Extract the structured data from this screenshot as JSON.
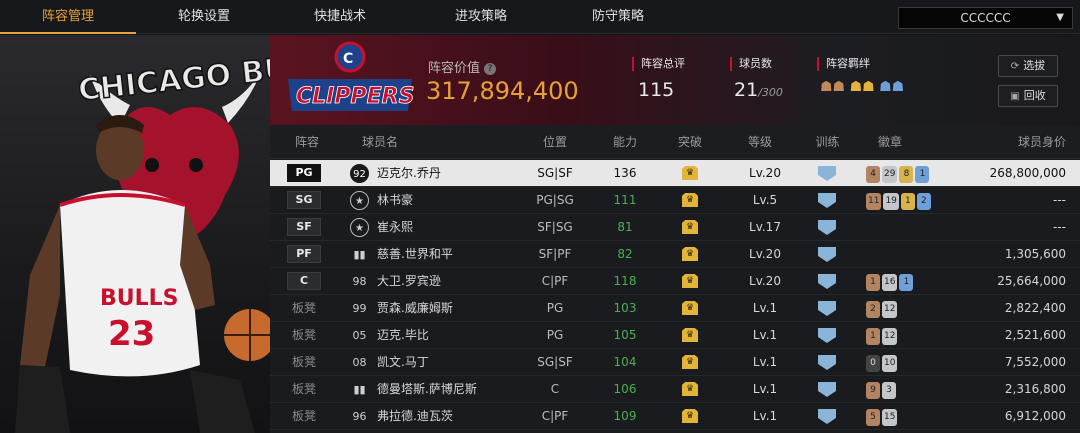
{
  "tabs": [
    "阵容管理",
    "轮换设置",
    "快捷战术",
    "进攻策略",
    "防守策略"
  ],
  "team_select": {
    "value": "CCCCCC"
  },
  "promo": {
    "team_text": "CHICAGO BULLS",
    "jersey_name": "BULLS",
    "jersey_number": "23"
  },
  "header": {
    "logo_text": "CLIPPERS",
    "lineup_value_label": "阵容价值",
    "lineup_value": "317,894,400",
    "stats": [
      {
        "label": "阵容总评",
        "value": "115",
        "suffix": ""
      },
      {
        "label": "球员数",
        "value": "21",
        "suffix": "/300"
      },
      {
        "label": "阵容羁绊",
        "value": "",
        "suffix": ""
      }
    ],
    "buttons": [
      {
        "label": "选拔",
        "icon": "refresh-icon"
      },
      {
        "label": "回收",
        "icon": "recycle-icon"
      }
    ]
  },
  "columns": [
    "阵容",
    "球员名",
    "位置",
    "能力",
    "突破",
    "等级",
    "训练",
    "徽章",
    "球员身价"
  ],
  "rows": [
    {
      "slot": "PG",
      "starter": true,
      "num": "92",
      "num_circle": true,
      "name": "迈克尔.乔丹",
      "pos": "SG|SF",
      "ability": "136",
      "level": "Lv.20",
      "badges": [
        [
          "4",
          "bronze"
        ],
        [
          "29",
          "silver"
        ],
        [
          "8",
          "gold"
        ],
        [
          "1",
          "blue"
        ]
      ],
      "price": "268,800,000",
      "selected": true
    },
    {
      "slot": "SG",
      "starter": true,
      "num": "★",
      "num_circle": true,
      "name": "林书豪",
      "pos": "PG|SG",
      "ability": "111",
      "level": "Lv.5",
      "badges": [
        [
          "11",
          "bronze"
        ],
        [
          "19",
          "silver"
        ],
        [
          "1",
          "gold"
        ],
        [
          "2",
          "blue"
        ]
      ],
      "price": "---"
    },
    {
      "slot": "SF",
      "starter": true,
      "num": "★",
      "num_circle": true,
      "name": "崔永熙",
      "pos": "SF|SG",
      "ability": "81",
      "level": "Lv.17",
      "badges": [],
      "price": "---"
    },
    {
      "slot": "PF",
      "starter": true,
      "num": "▮▮",
      "num_circle": false,
      "name": "慈善.世界和平",
      "pos": "SF|PF",
      "ability": "82",
      "level": "Lv.20",
      "badges": [],
      "price": "1,305,600"
    },
    {
      "slot": "C",
      "starter": true,
      "num": "98",
      "num_circle": false,
      "name": "大卫.罗宾逊",
      "pos": "C|PF",
      "ability": "118",
      "level": "Lv.20",
      "badges": [
        [
          "1",
          "bronze"
        ],
        [
          "16",
          "silver"
        ],
        [
          "1",
          "blue"
        ]
      ],
      "price": "25,664,000"
    },
    {
      "slot": "板凳",
      "starter": false,
      "num": "99",
      "num_circle": false,
      "name": "贾森.威廉姆斯",
      "pos": "PG",
      "ability": "103",
      "level": "Lv.1",
      "badges": [
        [
          "2",
          "bronze"
        ],
        [
          "12",
          "silver"
        ]
      ],
      "price": "2,822,400"
    },
    {
      "slot": "板凳",
      "starter": false,
      "num": "05",
      "num_circle": false,
      "name": "迈克.毕比",
      "pos": "PG",
      "ability": "105",
      "level": "Lv.1",
      "badges": [
        [
          "1",
          "bronze"
        ],
        [
          "12",
          "silver"
        ]
      ],
      "price": "2,521,600"
    },
    {
      "slot": "板凳",
      "starter": false,
      "num": "08",
      "num_circle": false,
      "name": "凯文.马丁",
      "pos": "SG|SF",
      "ability": "104",
      "level": "Lv.1",
      "badges": [
        [
          "0",
          "dark"
        ],
        [
          "10",
          "silver"
        ]
      ],
      "price": "7,552,000"
    },
    {
      "slot": "板凳",
      "starter": false,
      "num": "▮▮",
      "num_circle": false,
      "name": "德曼塔斯.萨博尼斯",
      "pos": "C",
      "ability": "106",
      "level": "Lv.1",
      "badges": [
        [
          "9",
          "bronze"
        ],
        [
          "3",
          "silver"
        ]
      ],
      "price": "2,316,800"
    },
    {
      "slot": "板凳",
      "starter": false,
      "num": "96",
      "num_circle": false,
      "name": "弗拉德.迪瓦茨",
      "pos": "C|PF",
      "ability": "109",
      "level": "Lv.1",
      "badges": [
        [
          "5",
          "bronze"
        ],
        [
          "15",
          "silver"
        ]
      ],
      "price": "6,912,000"
    }
  ],
  "colors": {
    "accent": "#e6a23a",
    "clippers_red": "#c8102e",
    "bulls_red": "#ce1141",
    "ability_green": "#4caf50"
  }
}
